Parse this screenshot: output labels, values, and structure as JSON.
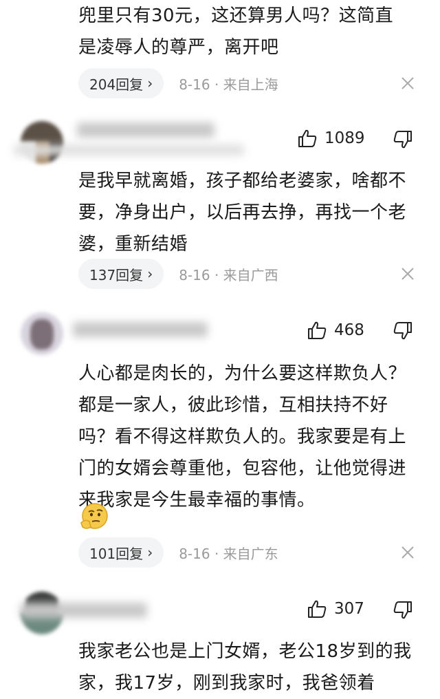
{
  "comments": [
    {
      "text_line1": "兜里只有30元，这还算男人吗？这简直",
      "text_line2": "是凌辱人的尊严，离开吧",
      "replies": "204回复",
      "date": "8-16",
      "location": "来自上海"
    },
    {
      "likes": "1089",
      "text": "是我早就离婚，孩子都给老婆家，啥都不要，净身出户，以后再去挣，再找一个老婆，重新结婚",
      "replies": "137回复",
      "date": "8-16",
      "location": "来自广西"
    },
    {
      "likes": "468",
      "text": "人心都是肉长的，为什么要这样欺负人？都是一家人，彼此珍惜，互相扶持不好吗？看不得这样欺负人的。我家要是有上门的女婿会尊重他，包容他，让他觉得进来我家是今生最幸福的事情。",
      "replies": "101回复",
      "date": "8-16",
      "location": "来自广东"
    },
    {
      "likes": "307",
      "text": "我家老公也是上门女婿，老公18岁到的我家，我17岁，刚到我家时，我爸领着"
    }
  ],
  "separator": "·",
  "icons": {
    "like": "thumbs-up-icon",
    "dislike": "thumbs-down-icon",
    "close": "close-icon",
    "chevron": "chevron-right-icon",
    "emoji": "thinking-face-emoji"
  }
}
